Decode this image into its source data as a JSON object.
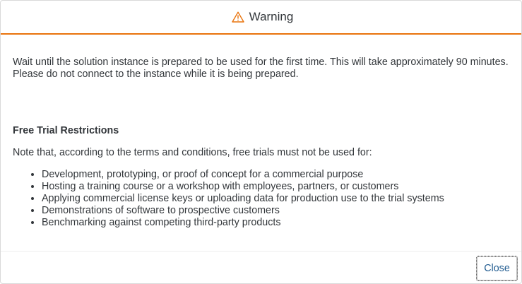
{
  "dialog": {
    "title": "Warning",
    "title_icon": "warning-triangle-icon",
    "accent_color": "#e9730c",
    "intro_line_1": "Wait until the solution instance is prepared to be used for the first time. This will take approximately 90 minutes.",
    "intro_line_2": "Please do not connect to the instance while it is being prepared.",
    "restrictions_title": "Free Trial Restrictions",
    "note": "Note that, according to the terms and conditions, free trials must not be used for:",
    "restrictions": [
      "Development, prototyping, or proof of concept for a commercial purpose",
      "Hosting a training course or a workshop with employees, partners, or customers",
      "Applying commercial license keys or uploading data for production use to the trial systems",
      "Demonstrations of software to prospective customers",
      "Benchmarking against competing third-party products"
    ],
    "close_label": "Close"
  }
}
